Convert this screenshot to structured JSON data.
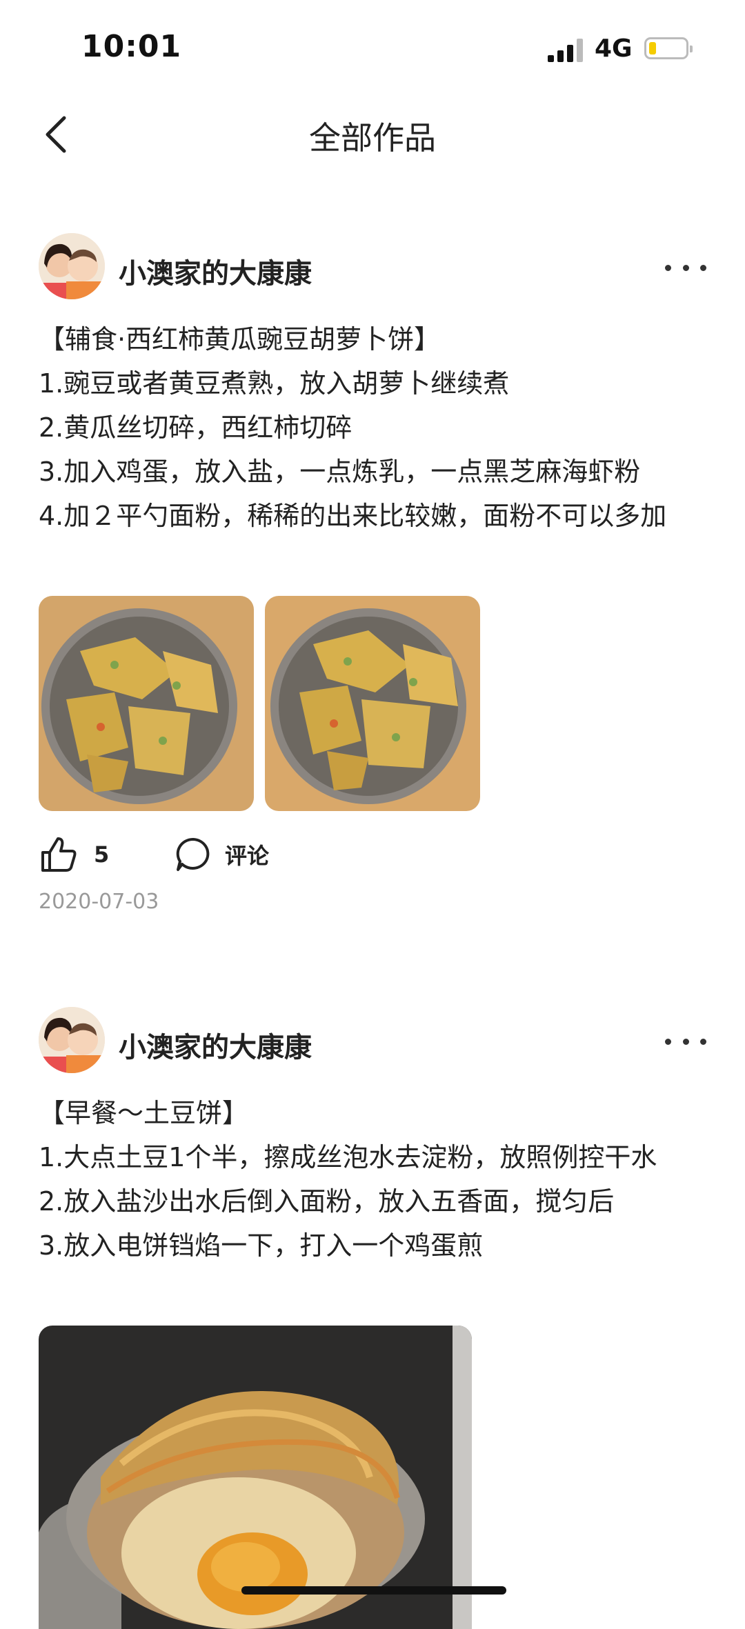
{
  "status": {
    "time": "10:01",
    "network": "4G"
  },
  "nav": {
    "title": "全部作品"
  },
  "posts": [
    {
      "author": "小澳家的大康康",
      "title": "【辅食·西红柿黄瓜豌豆胡萝卜饼】",
      "lines": [
        "1.豌豆或者黄豆煮熟，放入胡萝卜继续煮",
        "2.黄瓜丝切碎，西红柿切碎",
        "3.加入鸡蛋，放入盐，一点炼乳，一点黑芝麻海虾粉",
        "4.加２平勺面粉，稀稀的出来比较嫩，面粉不可以多加"
      ],
      "likes": "5",
      "comment_label": "评论",
      "date": "2020-07-03"
    },
    {
      "author": "小澳家的大康康",
      "title": "【早餐～土豆饼】",
      "lines": [
        "1.大点土豆1个半，擦成丝泡水去淀粉，放照例控干水",
        "2.放入盐沙出水后倒入面粉，放入五香面，搅匀后",
        "3.放入电饼铛焰一下，打入一个鸡蛋煎"
      ]
    }
  ],
  "colors": {
    "battery_level": "#f5cc00",
    "date_gray": "#999999"
  },
  "icons": [
    "back-icon",
    "more-icon",
    "like-icon",
    "comment-icon"
  ]
}
